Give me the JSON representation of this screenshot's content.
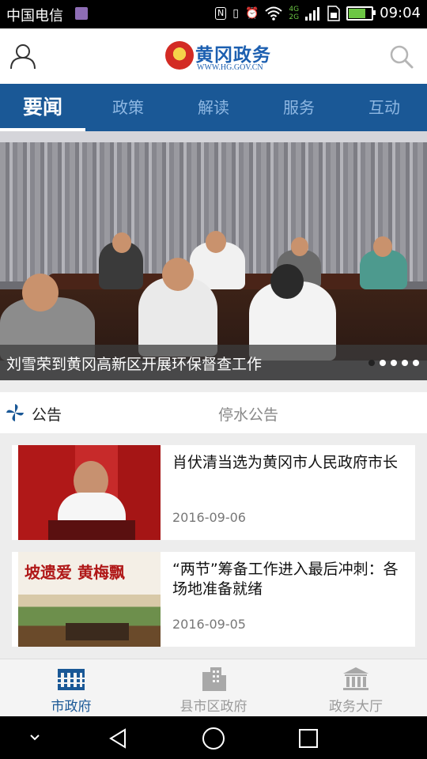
{
  "status_bar": {
    "carrier": "中国电信",
    "network_labels": [
      "4G",
      "2G"
    ],
    "time": "09:04",
    "icons": [
      "sim-icon",
      "nfc-icon",
      "vibrate-icon",
      "alarm-icon",
      "wifi-icon",
      "signal-icon",
      "sim-card-icon",
      "battery-icon"
    ]
  },
  "header": {
    "logo_title": "黄冈政务",
    "logo_url": "WWW.HG.GOV.CN",
    "left_icon": "user-icon",
    "right_icon": "search-icon"
  },
  "tabs": [
    {
      "label": "要闻",
      "active": true
    },
    {
      "label": "政策",
      "active": false
    },
    {
      "label": "解读",
      "active": false
    },
    {
      "label": "服务",
      "active": false
    },
    {
      "label": "互动",
      "active": false
    }
  ],
  "hero": {
    "caption": "刘雪荣到黄冈高新区开展环保督查工作",
    "slide_count": 5,
    "active_slide": 1
  },
  "notice": {
    "label": "公告",
    "text": "停水公告",
    "icon": "pinwheel-icon"
  },
  "news": [
    {
      "title": "肖伏清当选为黄冈市人民政府市长",
      "date": "2016-09-06"
    },
    {
      "title": "“两节”筹备工作进入最后冲刺：各场地准备就绪",
      "date": "2016-09-05",
      "thumb_text": "坡遗爱 黄梅飘"
    }
  ],
  "bottom_nav": [
    {
      "label": "市政府",
      "icon": "city-government-icon",
      "active": true
    },
    {
      "label": "县市区政府",
      "icon": "county-buildings-icon",
      "active": false
    },
    {
      "label": "政务大厅",
      "icon": "government-hall-icon",
      "active": false
    }
  ],
  "colors": {
    "brand_blue": "#1a5896",
    "tab_inactive": "#8fb8e3",
    "emblem_red": "#d32b24"
  }
}
